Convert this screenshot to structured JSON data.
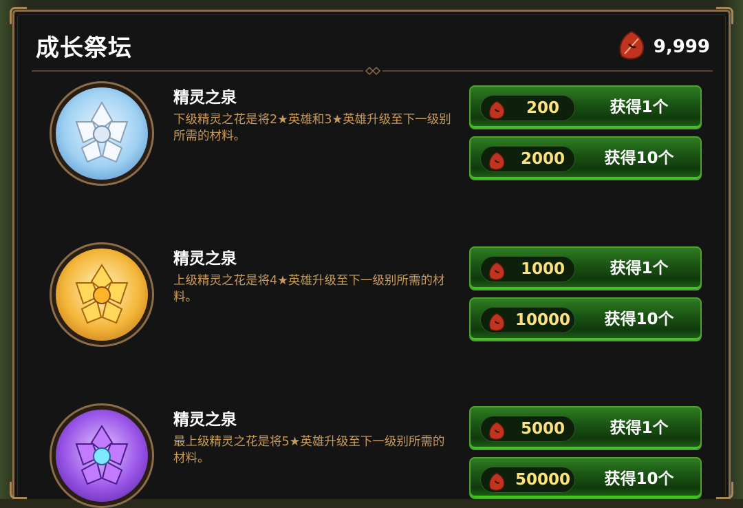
{
  "header": {
    "title": "成长祭坛",
    "currency_value": "9,999",
    "currency_icon": "red-leaf-icon"
  },
  "items": [
    {
      "name": "精灵之泉",
      "desc": "下级精灵之花是将2★英雄和3★英雄升级至下一级别所需的材料。",
      "medal": "silver-crystal-flower",
      "buttons": [
        {
          "price": "200",
          "label": "获得1个"
        },
        {
          "price": "2000",
          "label": "获得10个"
        }
      ]
    },
    {
      "name": "精灵之泉",
      "desc": "上级精灵之花是将4★英雄升级至下一级别所需的材料。",
      "medal": "gold-crystal-flower",
      "buttons": [
        {
          "price": "1000",
          "label": "获得1个"
        },
        {
          "price": "10000",
          "label": "获得10个"
        }
      ]
    },
    {
      "name": "精灵之泉",
      "desc": "最上级精灵之花是将5★英雄升级至下一级别所需的材料。",
      "medal": "purple-crystal-flower",
      "buttons": [
        {
          "price": "5000",
          "label": "获得1个"
        },
        {
          "price": "50000",
          "label": "获得10个"
        }
      ]
    }
  ],
  "colors": {
    "accent_green": "#2e7d22",
    "desc_text": "#c89a5a",
    "price_text": "#ffe27a"
  }
}
